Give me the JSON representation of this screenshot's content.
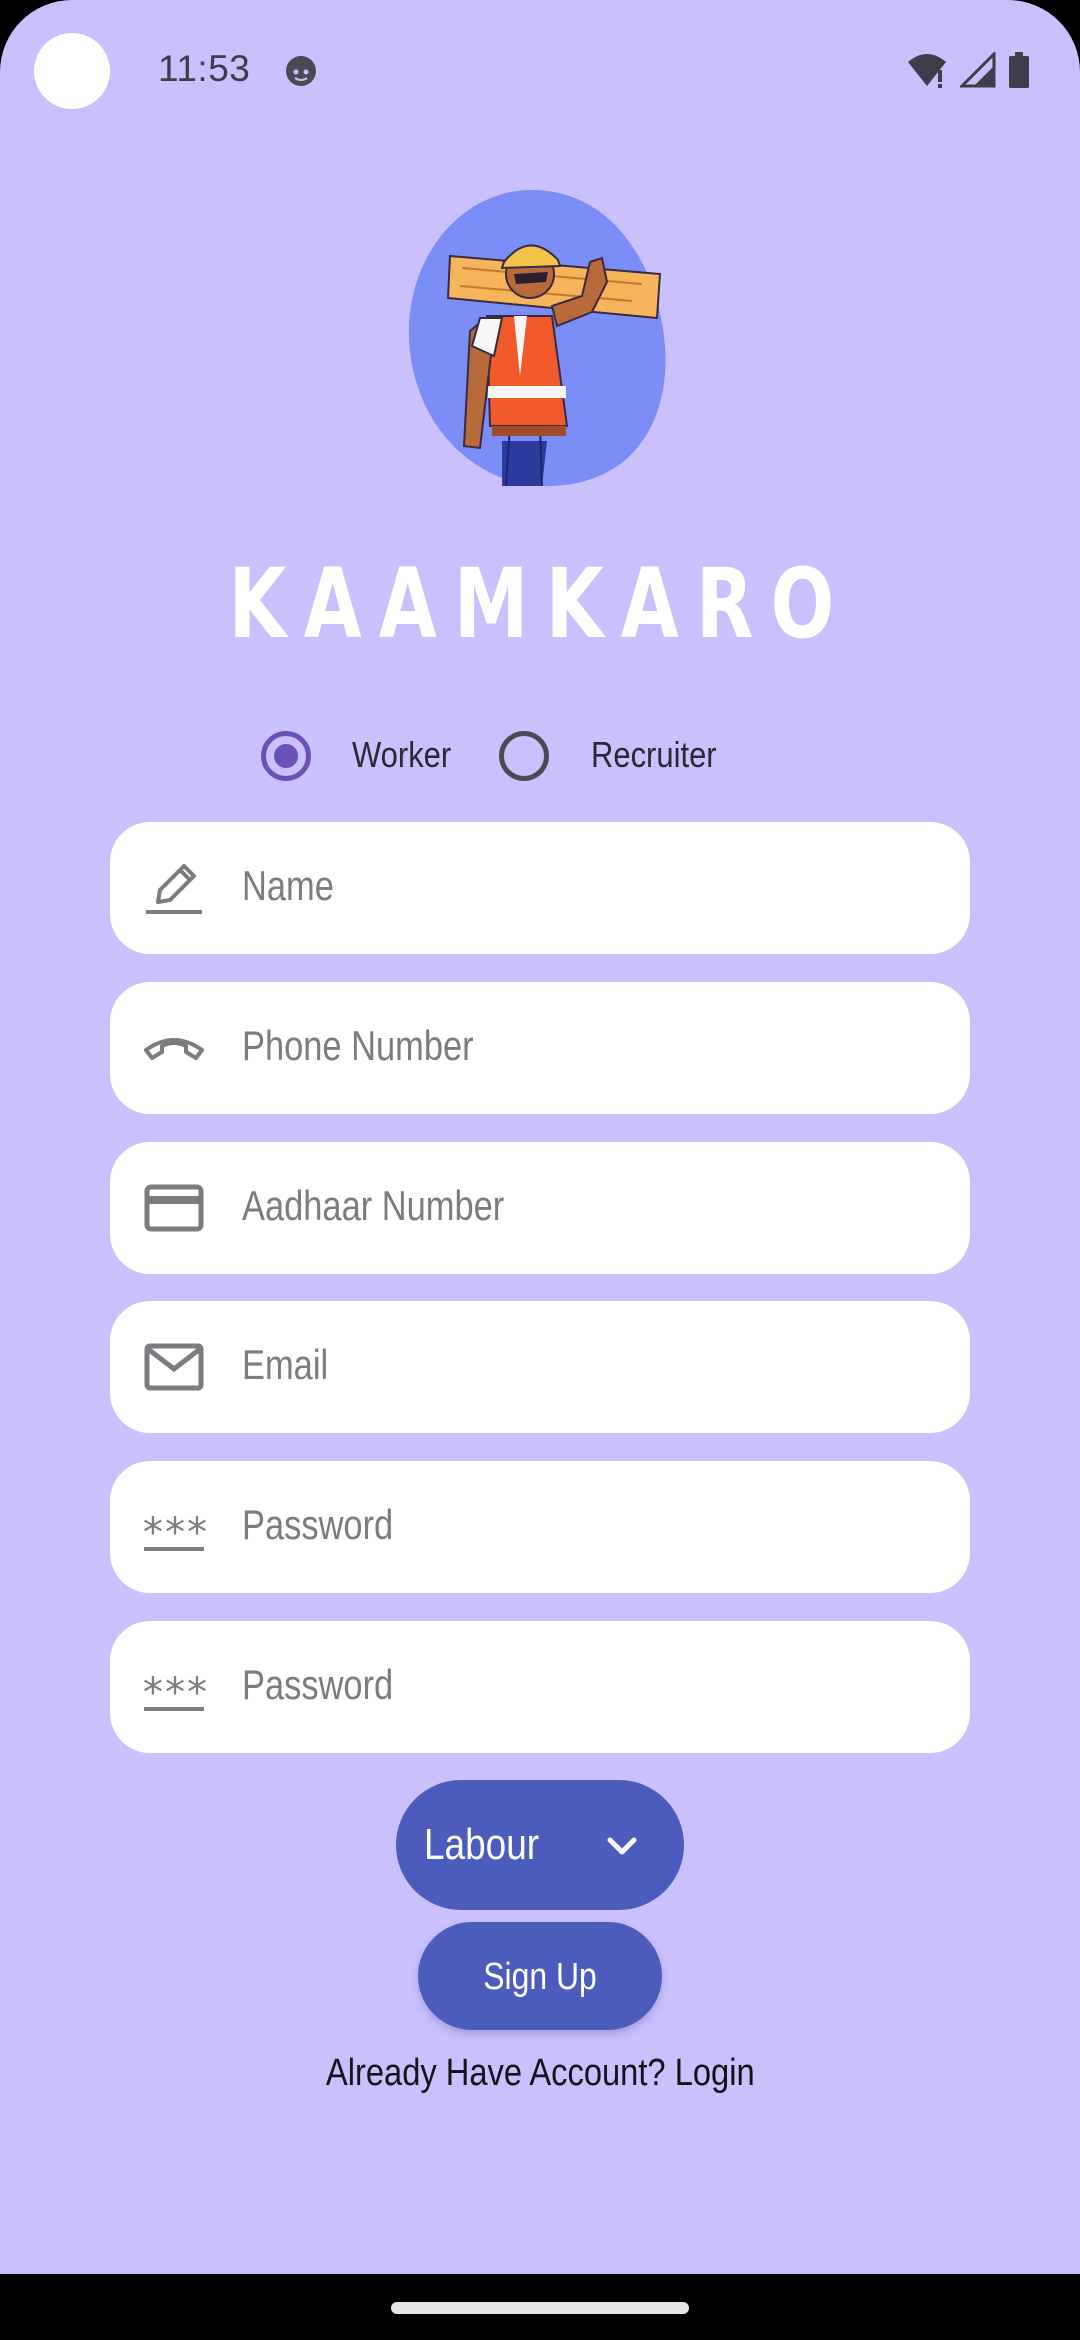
{
  "status_bar": {
    "time": "11:53"
  },
  "app": {
    "title": "KAAMKARO"
  },
  "roles": [
    {
      "label": "Worker",
      "selected": true
    },
    {
      "label": "Recruiter",
      "selected": false
    }
  ],
  "form": {
    "name_placeholder": "Name",
    "phone_placeholder": "Phone Number",
    "aadhaar_placeholder": "Aadhaar Number",
    "email_placeholder": "Email",
    "password_placeholder": "Password",
    "confirm_password_placeholder": "Password"
  },
  "category_dropdown": {
    "selected": "Labour"
  },
  "signup_button": {
    "label": "Sign Up"
  },
  "login_prompt": {
    "text": "Already Have Account?",
    "link": "Login"
  },
  "colors": {
    "background": "#c9c0fd",
    "accent": "#4b5cbd",
    "radio_selected": "#6b50b8"
  }
}
